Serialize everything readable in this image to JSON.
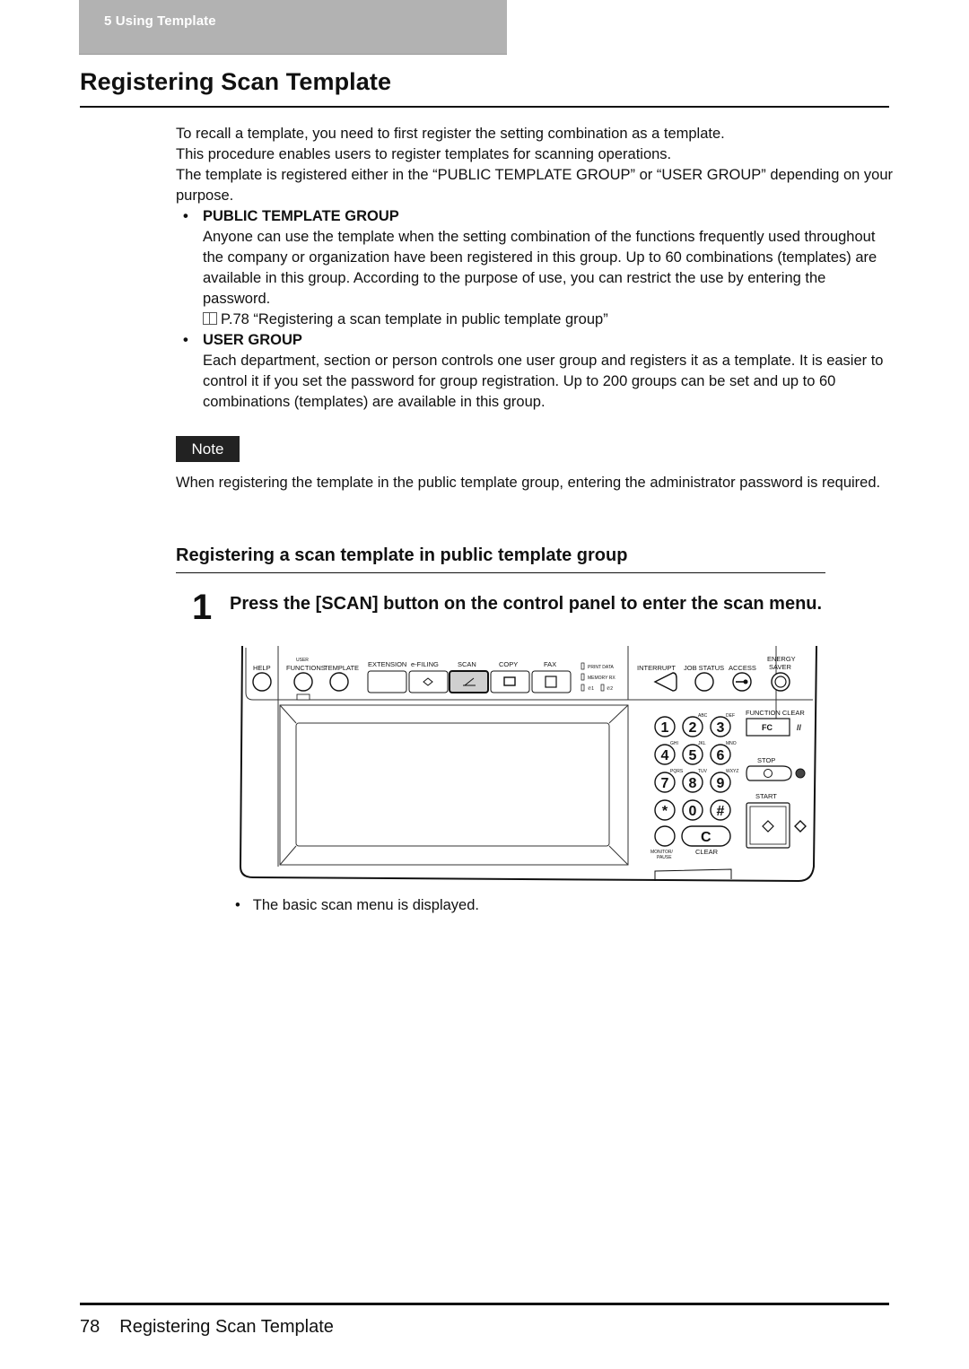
{
  "chapter": {
    "label": "5   Using Template"
  },
  "page": {
    "title": "Registering Scan Template",
    "intro": [
      "To recall a template, you need to first register the setting combination as a template.",
      "This procedure enables users to register templates for scanning operations.",
      "The template is registered either in the “PUBLIC TEMPLATE GROUP” or “USER GROUP” depending on your purpose."
    ],
    "groups": [
      {
        "heading": "PUBLIC TEMPLATE GROUP",
        "text": "Anyone can use the template when the setting combination of the functions frequently used throughout the company or organization have been registered in this group. Up to 60 combinations (templates) are available in this group. According to the purpose of use, you can restrict the use by entering the password.",
        "reference": "P.78 “Registering a scan template in public template group”"
      },
      {
        "heading": "USER GROUP",
        "text": "Each department, section or person controls one user group and registers it as a template. It is easier to control it if you set the password for group registration. Up to 200 groups can be set and up to 60 combinations (templates) are available in this group."
      }
    ],
    "note": {
      "badge": "Note",
      "text": "When registering the template in the public template group, entering the administrator password is required."
    },
    "section": {
      "heading": "Registering a scan template in public template group",
      "steps": [
        {
          "number": "1",
          "instruction": "Press the [SCAN] button on the control panel to enter the scan menu.",
          "result": "The basic scan menu is displayed."
        }
      ]
    }
  },
  "control_panel": {
    "left_buttons": [
      "HELP",
      "USER FUNCTIONS",
      "TEMPLATE"
    ],
    "function_buttons": [
      "EXTENSION",
      "e-FILING",
      "SCAN",
      "COPY",
      "FAX"
    ],
    "highlighted": "SCAN",
    "indicators": [
      "PRINT DATA",
      "MEMORY RX",
      "1",
      "2"
    ],
    "right_buttons": [
      "INTERRUPT",
      "JOB STATUS",
      "ACCESS",
      "ENERGY SAVER"
    ],
    "keypad": [
      {
        "key": "1",
        "sub": ""
      },
      {
        "key": "2",
        "sub": "ABC"
      },
      {
        "key": "3",
        "sub": "DEF"
      },
      {
        "key": "4",
        "sub": "GHI"
      },
      {
        "key": "5",
        "sub": "JKL"
      },
      {
        "key": "6",
        "sub": "MNO"
      },
      {
        "key": "7",
        "sub": "PQRS"
      },
      {
        "key": "8",
        "sub": "TUV"
      },
      {
        "key": "9",
        "sub": "WXYZ"
      },
      {
        "key": "*",
        "sub": ""
      },
      {
        "key": "0",
        "sub": ""
      },
      {
        "key": "#",
        "sub": ""
      }
    ],
    "function_clear": {
      "label": "FUNCTION CLEAR",
      "key": "FC"
    },
    "stop": "STOP",
    "start": "START",
    "clear": {
      "label": "CLEAR",
      "key": "C"
    },
    "monitor": "MONITOR/ PAUSE"
  },
  "footer": {
    "page_number": "78",
    "title": "Registering Scan Template"
  }
}
